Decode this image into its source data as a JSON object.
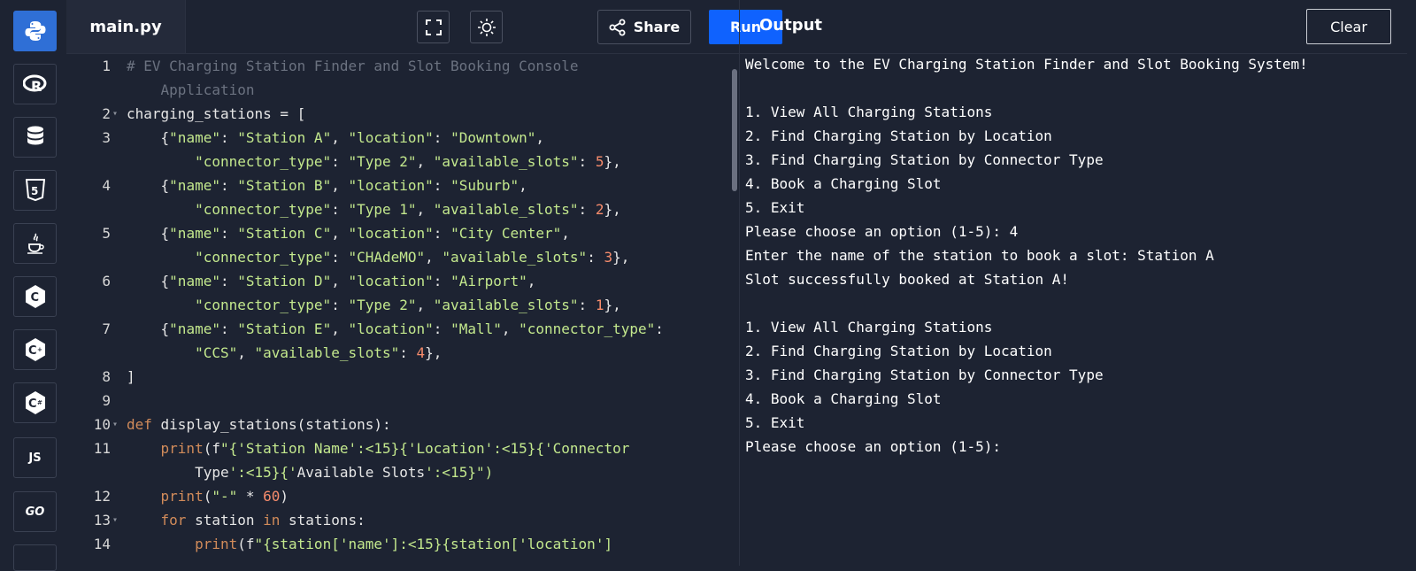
{
  "rail": [
    {
      "name": "python-icon",
      "active": true
    },
    {
      "name": "r-icon"
    },
    {
      "name": "database-icon"
    },
    {
      "name": "html5-icon"
    },
    {
      "name": "java-icon"
    },
    {
      "name": "c-icon"
    },
    {
      "name": "cpp-icon"
    },
    {
      "name": "csharp-icon"
    },
    {
      "name": "js-icon",
      "label": "JS"
    },
    {
      "name": "go-icon",
      "label": "GO"
    }
  ],
  "editor": {
    "file_tab": "main.py",
    "share_label": "Share",
    "run_label": "Run",
    "icons": [
      "fullscreen-icon",
      "theme-toggle-icon",
      "share-icon"
    ]
  },
  "code_lines": [
    {
      "ln": "1",
      "text": "# EV Charging Station Finder and Slot Booking Console"
    },
    {
      "ln": "",
      "text": "    Application"
    },
    {
      "ln": "2",
      "text": "charging_stations = [",
      "fold": true
    },
    {
      "ln": "3",
      "text": "    {\"name\": \"Station A\", \"location\": \"Downtown\","
    },
    {
      "ln": "",
      "text": "        \"connector_type\": \"Type 2\", \"available_slots\": 5},"
    },
    {
      "ln": "4",
      "text": "    {\"name\": \"Station B\", \"location\": \"Suburb\","
    },
    {
      "ln": "",
      "text": "        \"connector_type\": \"Type 1\", \"available_slots\": 2},"
    },
    {
      "ln": "5",
      "text": "    {\"name\": \"Station C\", \"location\": \"City Center\","
    },
    {
      "ln": "",
      "text": "        \"connector_type\": \"CHAdeMO\", \"available_slots\": 3},"
    },
    {
      "ln": "6",
      "text": "    {\"name\": \"Station D\", \"location\": \"Airport\","
    },
    {
      "ln": "",
      "text": "        \"connector_type\": \"Type 2\", \"available_slots\": 1},"
    },
    {
      "ln": "7",
      "text": "    {\"name\": \"Station E\", \"location\": \"Mall\", \"connector_type\":"
    },
    {
      "ln": "",
      "text": "        \"CCS\", \"available_slots\": 4},"
    },
    {
      "ln": "8",
      "text": "]"
    },
    {
      "ln": "9",
      "text": ""
    },
    {
      "ln": "10",
      "text": "def display_stations(stations):",
      "fold": true
    },
    {
      "ln": "11",
      "text": "    print(f\"{'Station Name':<15}{'Location':<15}{'Connector"
    },
    {
      "ln": "",
      "text": "        Type':<15}{'Available Slots':<15}\")"
    },
    {
      "ln": "12",
      "text": "    print(\"-\" * 60)"
    },
    {
      "ln": "13",
      "text": "    for station in stations:",
      "fold": true
    },
    {
      "ln": "14",
      "text": "        print(f\"{station['name']:<15}{station['location']"
    }
  ],
  "output": {
    "title": "Output",
    "clear_label": "Clear",
    "lines": [
      "Welcome to the EV Charging Station Finder and Slot Booking System!",
      "",
      "1. View All Charging Stations",
      "2. Find Charging Station by Location",
      "3. Find Charging Station by Connector Type",
      "4. Book a Charging Slot",
      "5. Exit",
      "Please choose an option (1-5): 4",
      "Enter the name of the station to book a slot: Station A",
      "Slot successfully booked at Station A!",
      "",
      "1. View All Charging Stations",
      "2. Find Charging Station by Location",
      "3. Find Charging Station by Connector Type",
      "4. Book a Charging Slot",
      "5. Exit",
      "Please choose an option (1-5):"
    ]
  },
  "colors": {
    "accent": "#0f62fe",
    "rail_active": "#2f6fd6",
    "background": "#1d2332"
  }
}
